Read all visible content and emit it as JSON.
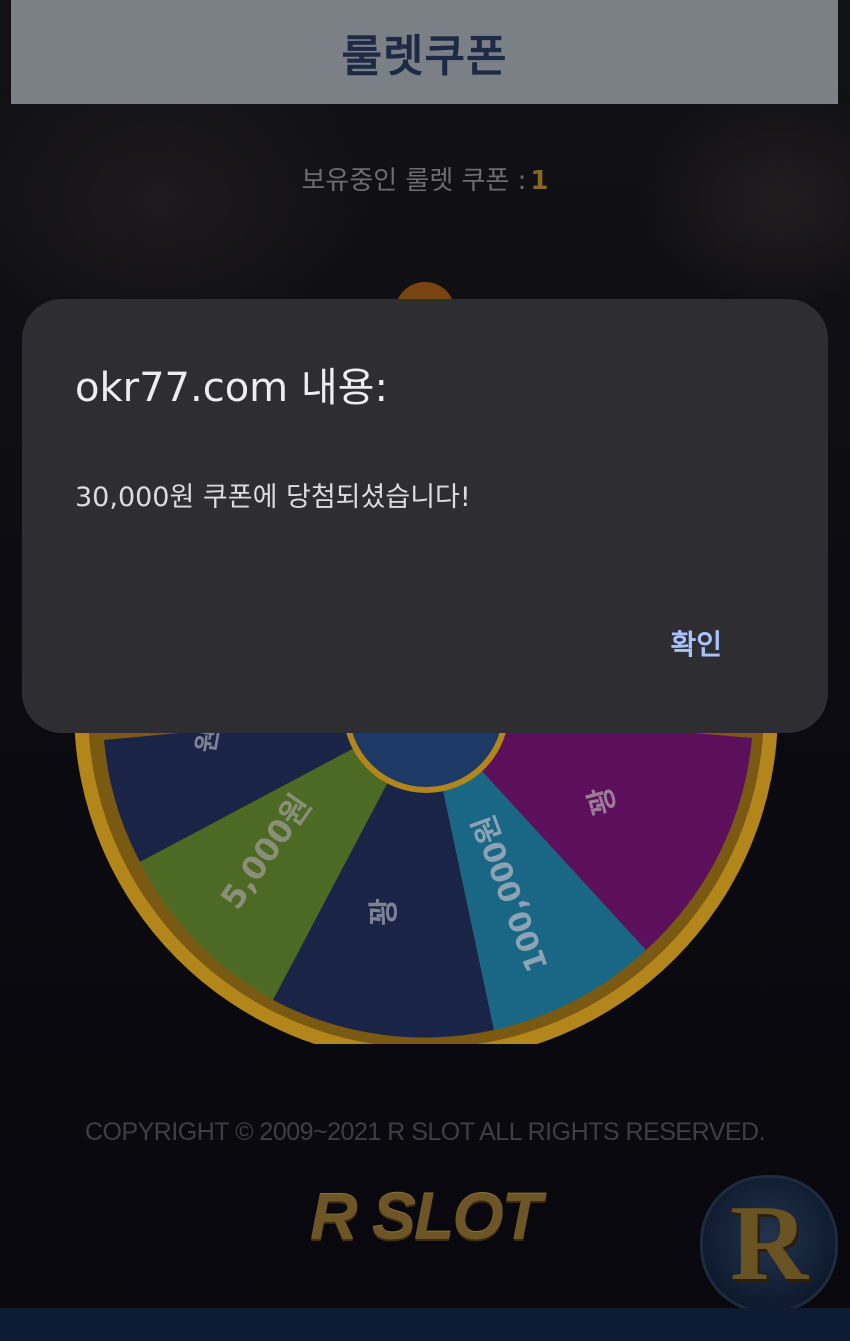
{
  "header": {
    "title": "룰렛쿠폰"
  },
  "coupon": {
    "label": "보유중인 룰렛 쿠폰 :",
    "count": "1"
  },
  "wheel": {
    "segment_labels": [
      "5,000원",
      "꽝",
      "100,000원",
      "꽝",
      "원"
    ],
    "colors": {
      "rim": "#b3861c",
      "navy": "#1a2446",
      "green": "#4d6a24",
      "cyan": "#1a6785",
      "magenta": "#5c0f5b",
      "hub": "#1d3a66"
    }
  },
  "footer": {
    "copyright": "COPYRIGHT © 2009~2021 R SLOT ALL RIGHTS RESERVED.",
    "logo": "R SLOT",
    "badge_letter": "R"
  },
  "dialog": {
    "title": "okr77.com 내용:",
    "message": "30,000원 쿠폰에 당첨되셨습니다!",
    "ok_label": "확인"
  }
}
